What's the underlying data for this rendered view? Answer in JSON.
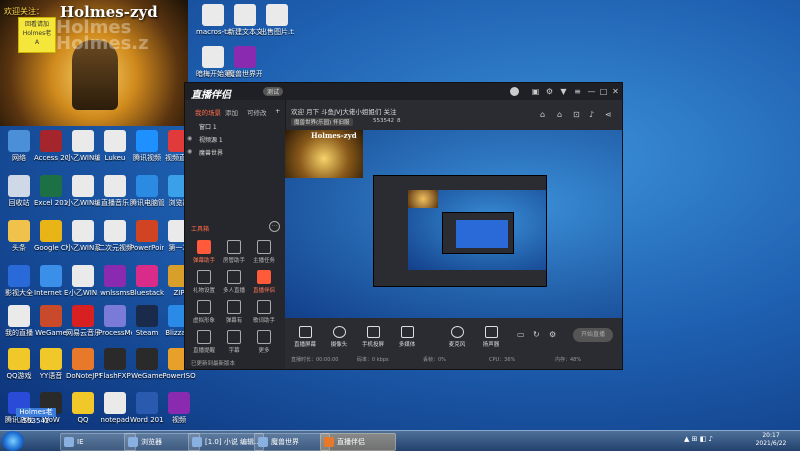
{
  "webcam": {
    "streamer_name": "Holmes-zyd",
    "tag_text": "欢迎关注：",
    "watermark": [
      "Holmes",
      "Holmes.z"
    ],
    "yellow_note": [
      "回看请加",
      "Holmes老",
      "A"
    ]
  },
  "desktop_icons": [
    {
      "label": "网络",
      "color": "#4a8fd8"
    },
    {
      "label": "Access 2010",
      "color": "#a4262c"
    },
    {
      "label": "小乙WIN编辑",
      "color": "#eaeaea"
    },
    {
      "label": "Lukeu",
      "color": "#eaeaea"
    },
    {
      "label": "腾讯视频",
      "color": "#1e90ff"
    },
    {
      "label": "视频直播",
      "color": "#e03a3a"
    },
    {
      "label": "回收站",
      "color": "#cfd8e6"
    },
    {
      "label": "Excel 2010",
      "color": "#1d7044"
    },
    {
      "label": "小乙WIN编辑",
      "color": "#eaeaea"
    },
    {
      "label": "直播音乐",
      "color": "#eaeaea"
    },
    {
      "label": "腾讯电脑管家",
      "color": "#2b8ae2"
    },
    {
      "label": "浏览器",
      "color": "#3aa0e8"
    },
    {
      "label": "头条",
      "color": "#f0c14b"
    },
    {
      "label": "Google Chrome",
      "color": "#e8b416"
    },
    {
      "label": "小乙WIN系统",
      "color": "#eaeaea"
    },
    {
      "label": "二次元视频",
      "color": "#eaeaea"
    },
    {
      "label": "PowerPoint",
      "color": "#d04423"
    },
    {
      "label": "第一次",
      "color": "#eaeaea"
    },
    {
      "label": "影视大全",
      "color": "#2a6ad8"
    },
    {
      "label": "Internet Explorer",
      "color": "#3a8fe8"
    },
    {
      "label": "小乙WIN",
      "color": "#eaeaea"
    },
    {
      "label": "wnlssms",
      "color": "#8a2ab0"
    },
    {
      "label": "Bluestacks",
      "color": "#d82b8a"
    },
    {
      "label": "ZIP",
      "color": "#d8a02b"
    },
    {
      "label": "我的直播",
      "color": "#eaeaea"
    },
    {
      "label": "WeGame",
      "color": "#c84a2a"
    },
    {
      "label": "网易云音乐",
      "color": "#d82020"
    },
    {
      "label": "ProcessMon",
      "color": "#7a7ad8"
    },
    {
      "label": "Steam",
      "color": "#1a2a4a"
    },
    {
      "label": "Blizzard",
      "color": "#2a8ae8"
    },
    {
      "label": "QQ游戏",
      "color": "#f0c82a"
    },
    {
      "label": "YY语音",
      "color": "#f0c82a"
    },
    {
      "label": "DoNoteJPS",
      "color": "#e8782a"
    },
    {
      "label": "FlashFXP",
      "color": "#2a2a2a"
    },
    {
      "label": "WeGame",
      "color": "#2a2a2a"
    },
    {
      "label": "PowerISO",
      "color": "#e8a02a"
    },
    {
      "label": "腾讯游戏",
      "color": "#2a4ad8"
    },
    {
      "label": "WoW",
      "color": "#2a2a2a"
    },
    {
      "label": "QQ",
      "color": "#f0c82a"
    },
    {
      "label": "notepad",
      "color": "#eaeaea"
    },
    {
      "label": "Word 2010",
      "color": "#2a5ab0"
    },
    {
      "label": "视频",
      "color": "#8a2ab0"
    }
  ],
  "top_desktop_icons": [
    {
      "label": "macros-tx...",
      "color": "#eaeaea"
    },
    {
      "label": "新建文本文档.txt",
      "color": "#eaeaea"
    },
    {
      "label": "出售图片.txt",
      "color": "#eaeaea"
    },
    {
      "label": "暗梅开始第...txt",
      "color": "#eaeaea"
    },
    {
      "label": "魔兽世界开始第工...",
      "color": "#8a2ab0"
    }
  ],
  "app": {
    "title": "直播伴侣",
    "version": "测试",
    "sidebar_tabs": [
      "我的场景",
      "添加",
      "可修改"
    ],
    "scenes": [
      "窗口 1",
      "视频源 1",
      "魔兽世界"
    ],
    "tools_title": "工具箱",
    "tools": [
      {
        "label": "弹幕助手",
        "red": true
      },
      {
        "label": "房管助手",
        "red": false
      },
      {
        "label": "主播任务",
        "red": false
      },
      {
        "label": "礼物设置",
        "red": false
      },
      {
        "label": "多人直播",
        "red": false
      },
      {
        "label": "直播伴侣",
        "red": true
      },
      {
        "label": "虚拟形象",
        "red": false
      },
      {
        "label": "弹幕有",
        "red": false
      },
      {
        "label": "歌词助手",
        "red": false
      },
      {
        "label": "直播提醒",
        "red": false
      },
      {
        "label": "字幕",
        "red": false
      },
      {
        "label": "更多",
        "red": false
      }
    ],
    "update_note": "已更新到最新版本",
    "stream_title": "欢迎 月下 斗鱼JVJ大佬小姐姐们 关注",
    "badge_game": "魔兽世界(乐园) 怀旧服",
    "viewers": "553542",
    "fans": "8",
    "bottom_buttons": [
      "直播屏幕",
      "摄像头",
      "手机投屏",
      "多媒体",
      "麦克风",
      "扬声器"
    ],
    "start_live": "开始直播",
    "status": [
      "直播时长：00:00:00",
      "码率：0 kbps",
      "丢帧：0%",
      "CPU：36%",
      "内存：48%"
    ]
  },
  "taskbar": {
    "items": [
      {
        "label": "IE",
        "active": false
      },
      {
        "label": "浏览器",
        "active": false
      },
      {
        "label": "[1.0] 小说 编辑...",
        "active": false
      },
      {
        "label": "魔兽世界",
        "active": false
      },
      {
        "label": "直播伴侣",
        "active": true
      }
    ],
    "time": "20:17",
    "date": "2021/6/22"
  },
  "user_badge": {
    "line1": "Holmes老",
    "line2": "553542"
  }
}
